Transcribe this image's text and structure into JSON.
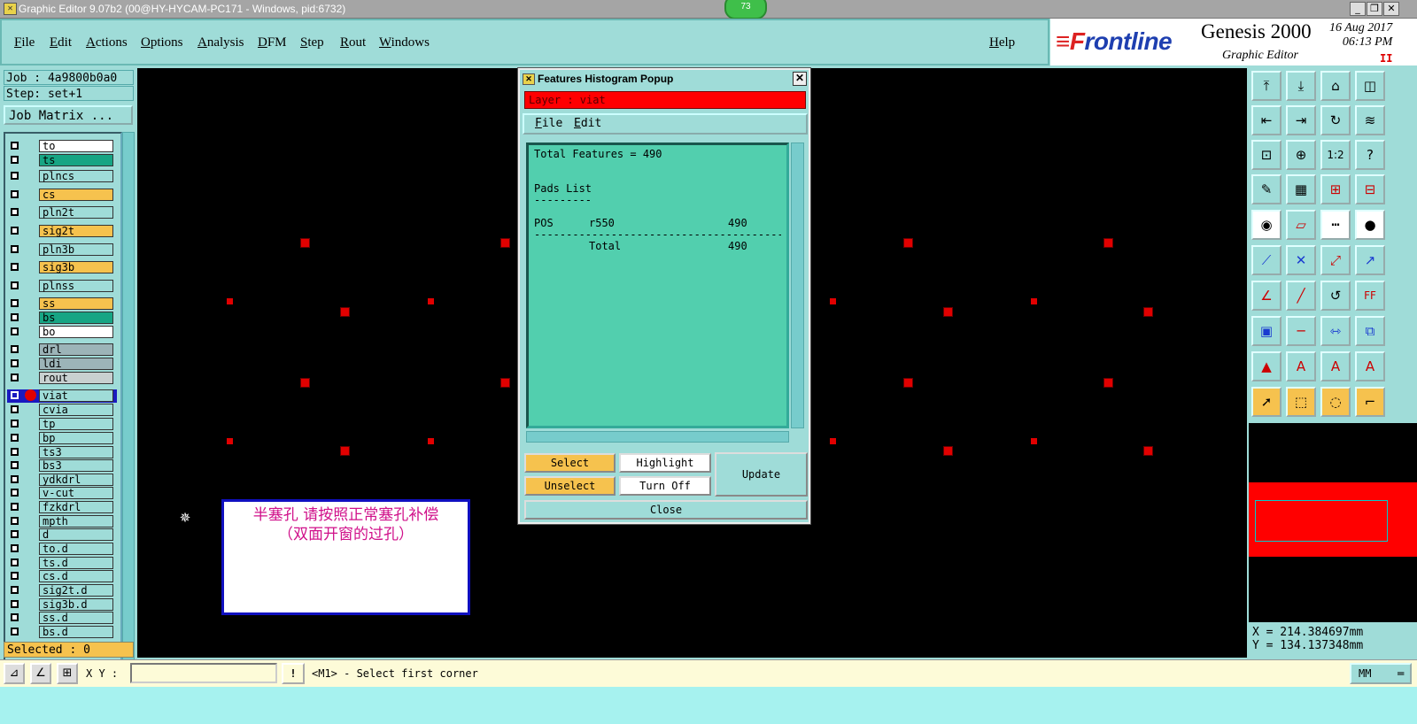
{
  "window": {
    "title": "Graphic Editor 9.07b2 (00@HY-HYCAM-PC171 - Windows, pid:6732)",
    "badge": "73",
    "btn_min": "_",
    "btn_restore": "❐",
    "btn_close": "✕"
  },
  "menu": {
    "file": "File",
    "edit": "Edit",
    "actions": "Actions",
    "options": "Options",
    "analysis": "Analysis",
    "dfm": "DFM",
    "step": "Step",
    "rout": "Rout",
    "windows": "Windows",
    "help": "Help"
  },
  "brand": {
    "logo_mark": "≡F",
    "logo_text": "rontline",
    "product": "Genesis 2000",
    "subtitle": "Graphic Editor",
    "date": "16 Aug 2017",
    "time": "06:13 PM",
    "mark": "II"
  },
  "job": {
    "job": "Job : 4a9800b0a0",
    "step": "Step: set+1",
    "matrix_button": "Job Matrix ..."
  },
  "layers": [
    {
      "name": "to",
      "color": "#ffffff"
    },
    {
      "name": "ts",
      "color": "#17a584"
    },
    {
      "name": "plncs",
      "color": "#9fdcd8"
    },
    {
      "name": "cs",
      "color": "#f6c24e"
    },
    {
      "name": "pln2t",
      "color": "#9fdcd8"
    },
    {
      "name": "sig2t",
      "color": "#f6c24e"
    },
    {
      "name": "pln3b",
      "color": "#9fdcd8"
    },
    {
      "name": "sig3b",
      "color": "#f6c24e"
    },
    {
      "name": "plnss",
      "color": "#9fdcd8"
    },
    {
      "name": "ss",
      "color": "#f6c24e"
    },
    {
      "name": "bs",
      "color": "#17a584"
    },
    {
      "name": "bo",
      "color": "#ffffff"
    },
    {
      "name": "drl",
      "color": "#9cb4b8"
    },
    {
      "name": "ldi",
      "color": "#9cb4b8"
    },
    {
      "name": "rout",
      "color": "#c8d0d0"
    },
    {
      "name": "viat",
      "color": "#9fdcd8"
    },
    {
      "name": "cvia",
      "color": "#9fdcd8"
    },
    {
      "name": "tp",
      "color": "#9fdcd8"
    },
    {
      "name": "bp",
      "color": "#9fdcd8"
    },
    {
      "name": "ts3",
      "color": "#9fdcd8"
    },
    {
      "name": "bs3",
      "color": "#9fdcd8"
    },
    {
      "name": "ydkdrl",
      "color": "#9fdcd8"
    },
    {
      "name": "v-cut",
      "color": "#9fdcd8"
    },
    {
      "name": "fzkdrl",
      "color": "#9fdcd8"
    },
    {
      "name": "mpth",
      "color": "#9fdcd8"
    },
    {
      "name": "d",
      "color": "#9fdcd8"
    },
    {
      "name": "to.d",
      "color": "#9fdcd8"
    },
    {
      "name": "ts.d",
      "color": "#9fdcd8"
    },
    {
      "name": "cs.d",
      "color": "#9fdcd8"
    },
    {
      "name": "sig2t.d",
      "color": "#9fdcd8"
    },
    {
      "name": "sig3b.d",
      "color": "#9fdcd8"
    },
    {
      "name": "ss.d",
      "color": "#9fdcd8"
    },
    {
      "name": "bs.d",
      "color": "#9fdcd8"
    }
  ],
  "selected_count": "Selected : 0",
  "note": {
    "line1": "半塞孔  请按照正常塞孔补偿",
    "line2": "（双面开窗的过孔）"
  },
  "popup": {
    "title": "Features Histogram Popup",
    "layer": "Layer :  viat",
    "menu_file": "File",
    "menu_edit": "Edit",
    "total_features": "Total Features = 490",
    "list_title": "Pads List",
    "list_rule": "---------",
    "row_pol": "POS",
    "row_sym": "r550",
    "row_count": "490",
    "sep": "------------------------------------------",
    "total_label": "Total",
    "total_count": "490",
    "btn_select": "Select",
    "btn_unselect": "Unselect",
    "btn_highlight": "Highlight",
    "btn_turnoff": "Turn Off",
    "btn_update": "Update",
    "btn_close": "Close"
  },
  "coords": {
    "x": "X = 214.384697mm",
    "y": "Y = 134.137348mm"
  },
  "bottom": {
    "xy_label": "X Y :",
    "warn": "!",
    "prompt": "<M1> - Select first corner",
    "units": "MM"
  }
}
